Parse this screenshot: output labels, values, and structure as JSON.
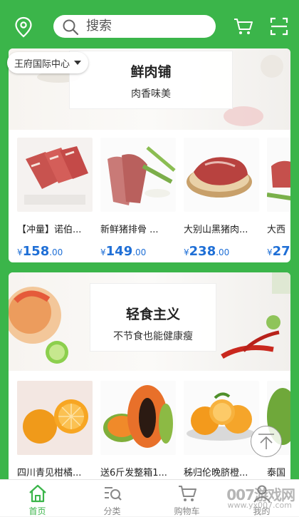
{
  "header": {
    "search_placeholder": "搜索",
    "location": "王府国际中心",
    "icons": [
      "location-pin-icon",
      "search-icon",
      "cart-icon",
      "scan-icon"
    ]
  },
  "sections": [
    {
      "title": "鲜肉铺",
      "subtitle": "肉香味美",
      "products": [
        {
          "name": "【冲量】诺伯...",
          "cur": "¥",
          "int": "158",
          "dec": ".00"
        },
        {
          "name": "新鲜猪排骨 ...",
          "cur": "¥",
          "int": "149",
          "dec": ".00"
        },
        {
          "name": "大别山黑猪肉...",
          "cur": "¥",
          "int": "238",
          "dec": ".00"
        },
        {
          "name": "大西",
          "cur": "¥",
          "int": "27",
          "dec": ""
        }
      ]
    },
    {
      "title": "轻食主义",
      "subtitle": "不节食也能健康瘦",
      "products": [
        {
          "name": "四川青见柑橘...",
          "cur": "",
          "int": "",
          "dec": ""
        },
        {
          "name": "送6斤发整箱1...",
          "cur": "",
          "int": "",
          "dec": ""
        },
        {
          "name": "秭归伦晚脐橙...",
          "cur": "",
          "int": "",
          "dec": ""
        },
        {
          "name": "泰国",
          "cur": "",
          "int": "",
          "dec": ""
        }
      ]
    }
  ],
  "tabbar": [
    {
      "label": "首页",
      "icon": "home-icon",
      "active": true
    },
    {
      "label": "分类",
      "icon": "category-search-icon",
      "active": false
    },
    {
      "label": "购物车",
      "icon": "cart-icon",
      "active": false
    },
    {
      "label": "我的",
      "icon": "user-icon",
      "active": false
    }
  ],
  "watermark": {
    "text": "007游戏网",
    "url": "www.yx007.com"
  },
  "colors": {
    "brand_green": "#3bb54a",
    "price_blue": "#1f6fd6"
  }
}
